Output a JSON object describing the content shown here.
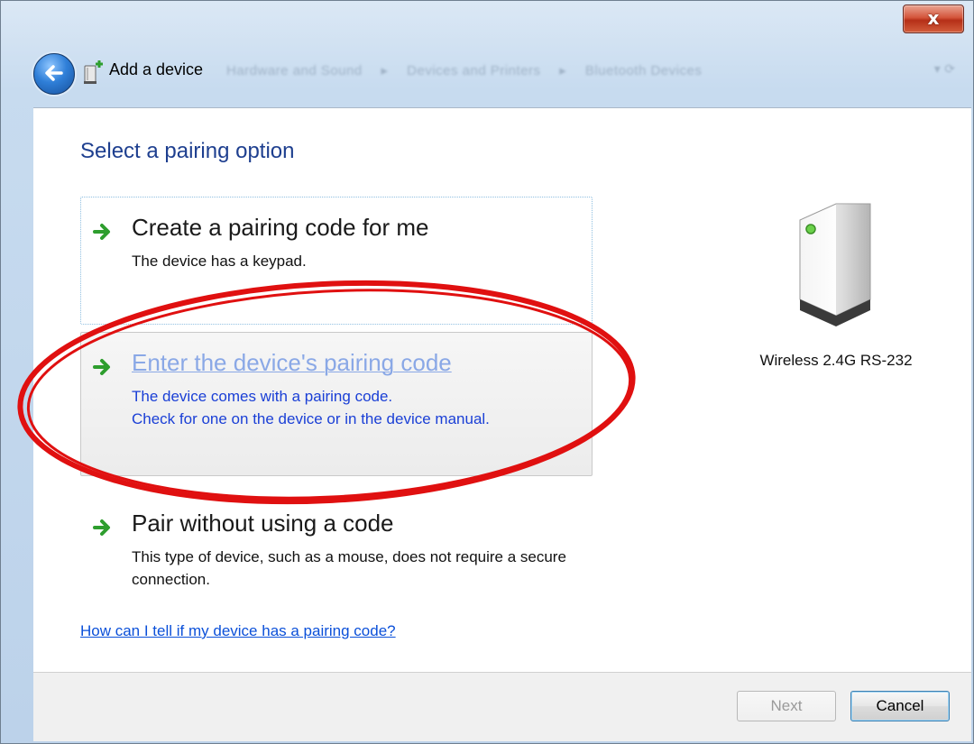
{
  "window": {
    "close_glyph": "x",
    "nav_title": "Add a device",
    "breadcrumb": [
      "Hardware and Sound",
      "Devices and Printers",
      "Bluetooth Devices"
    ],
    "breadcrumb_sep": "▸"
  },
  "main": {
    "heading": "Select a pairing option",
    "options": [
      {
        "title": "Create a pairing code for me",
        "description": "The device has a keypad."
      },
      {
        "title": "Enter the device's pairing code",
        "description_line1": "The device comes with a pairing code.",
        "description_line2": "Check for one on the device or in the device manual."
      },
      {
        "title": "Pair without using a code",
        "description": "This type of device, such as a mouse, does not require a secure connection."
      }
    ],
    "help_link": "How can I tell if my device has a pairing code?"
  },
  "device": {
    "name": "Wireless 2.4G RS-232",
    "icon": "wireless-device-icon"
  },
  "footer": {
    "next_label": "Next",
    "cancel_label": "Cancel"
  },
  "colors": {
    "heading": "#1e3f8f",
    "link": "#0b50d9",
    "annotation_ellipse": "#e01010",
    "arrow_green": "#2e9e2e"
  }
}
